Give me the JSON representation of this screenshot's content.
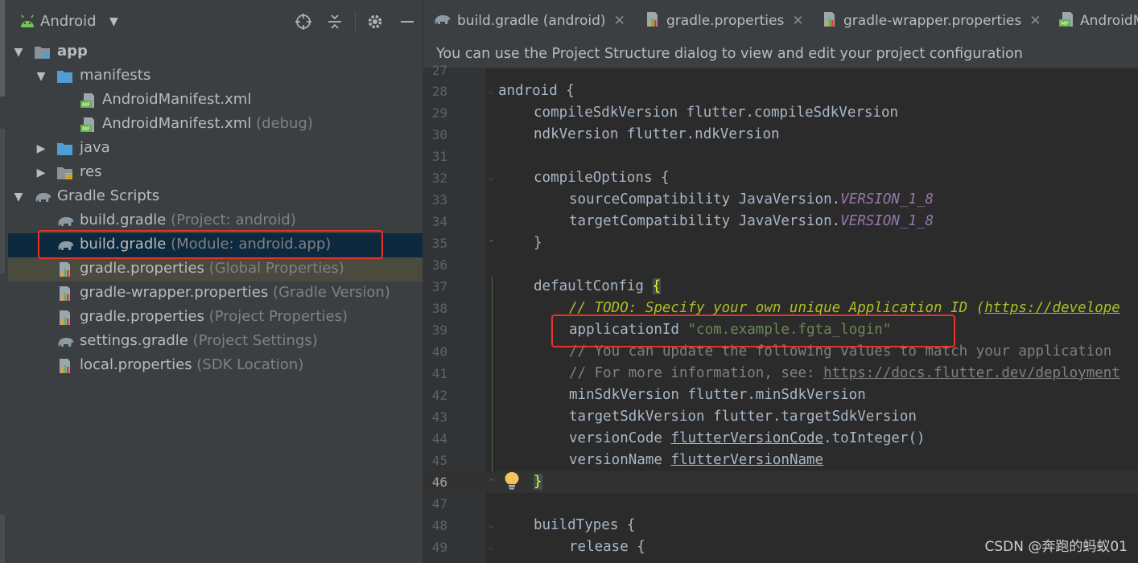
{
  "project_panel": {
    "title": "Android",
    "tree": [
      {
        "name": "app",
        "hint": ""
      },
      {
        "name": "manifests",
        "hint": ""
      },
      {
        "name": "AndroidManifest.xml",
        "hint": ""
      },
      {
        "name": "AndroidManifest.xml",
        "hint": "(debug)"
      },
      {
        "name": "java",
        "hint": ""
      },
      {
        "name": "res",
        "hint": ""
      },
      {
        "name": "Gradle Scripts",
        "hint": ""
      },
      {
        "name": "build.gradle",
        "hint": "(Project: android)"
      },
      {
        "name": "build.gradle",
        "hint": "(Module: android.app)"
      },
      {
        "name": "gradle.properties",
        "hint": "(Global Properties)"
      },
      {
        "name": "gradle-wrapper.properties",
        "hint": "(Gradle Version)"
      },
      {
        "name": "gradle.properties",
        "hint": "(Project Properties)"
      },
      {
        "name": "settings.gradle",
        "hint": "(Project Settings)"
      },
      {
        "name": "local.properties",
        "hint": "(SDK Location)"
      }
    ]
  },
  "tabs": [
    {
      "label": "build.gradle (android)"
    },
    {
      "label": "gradle.properties"
    },
    {
      "label": "gradle-wrapper.properties"
    },
    {
      "label": "AndroidM"
    }
  ],
  "banner": "You can use the Project Structure dialog to view and edit your project configuration",
  "editor": {
    "line_numbers": [
      "27",
      "28",
      "29",
      "30",
      "31",
      "32",
      "33",
      "34",
      "35",
      "36",
      "37",
      "38",
      "39",
      "40",
      "41",
      "42",
      "43",
      "44",
      "45",
      "46",
      "47",
      "48",
      "49"
    ],
    "code": {
      "l28": "android {",
      "l29": "compileSdkVersion flutter.compileSdkVersion",
      "l30": "ndkVersion flutter.ndkVersion",
      "l32": "compileOptions {",
      "l33_a": "sourceCompatibility JavaVersion.",
      "l33_b": "VERSION_1_8",
      "l34_a": "targetCompatibility JavaVersion.",
      "l34_b": "VERSION_1_8",
      "l35": "}",
      "l37_a": "defaultConfig ",
      "l37_b": "{",
      "l38_a": "// ",
      "l38_b": "TODO: Specify your own unique Application ID (",
      "l38_c": "https://develope",
      "l39_a": "applicationId ",
      "l39_b": "\"com.example.fgta_login\"",
      "l40": "// You can update the following values to match your application",
      "l41_a": "// For more information, see: ",
      "l41_b": "https://docs.flutter.dev/deployment",
      "l42": "minSdkVersion flutter.minSdkVersion",
      "l43": "targetSdkVersion flutter.targetSdkVersion",
      "l44_a": "versionCode ",
      "l44_b": "flutterVersionCode",
      "l44_c": ".toInteger()",
      "l45_a": "versionName ",
      "l45_b": "flutterVersionName",
      "l46": "}",
      "l48": "buildTypes {",
      "l49": "release {"
    }
  },
  "watermark": "CSDN @奔跑的蚂蚁01",
  "colors": {
    "selection": "#0d293e",
    "annotation_box": "#e5322b",
    "keyword_constant": "#9876aa",
    "string": "#6a8759",
    "todo": "#a8c023"
  },
  "icons": [
    "android-icon",
    "chevron-down-icon",
    "locate-icon",
    "collapse-all-icon",
    "gear-icon",
    "minimize-icon",
    "module-folder-icon",
    "folder-icon",
    "manifest-file-icon",
    "gradle-elephant-icon",
    "properties-file-icon",
    "lightbulb-icon",
    "close-icon"
  ]
}
